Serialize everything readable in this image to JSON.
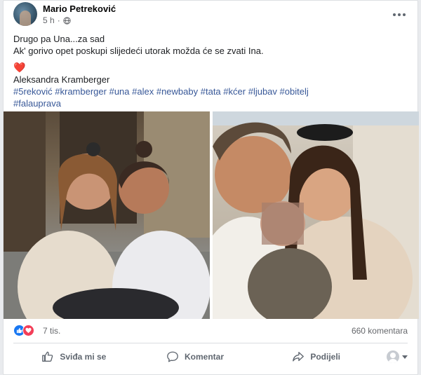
{
  "post": {
    "author": "Mario Petreković",
    "time": "5 h",
    "separator": "·",
    "text_line1": "Drugo pa Una...za sad",
    "text_line2": "Ak' gorivo opet poskupi slijedeći utorak možda će se zvati Ina.",
    "heart": "❤️",
    "tagged_name": "Aleksandra Kramberger",
    "hashtags": [
      "#5reković",
      "#kramberger",
      "#una",
      "#alex",
      "#newbaby",
      "#tata",
      "#kćer",
      "#ljubav",
      "#obitelj",
      "#falauprava"
    ]
  },
  "reactions": {
    "count": "7 tis.",
    "comments": "660 komentara"
  },
  "actions": {
    "like": "Sviđa mi se",
    "comment": "Komentar",
    "share": "Podijeli"
  },
  "icons": {
    "globe": "globe-icon",
    "more": "more-options-icon",
    "like": "thumbs-up-icon",
    "comment": "comment-bubble-icon",
    "share": "share-arrow-icon"
  },
  "colors": {
    "link": "#385898",
    "like_blue": "#1877f2",
    "love_red": "#f33e58",
    "muted": "#65676b"
  }
}
